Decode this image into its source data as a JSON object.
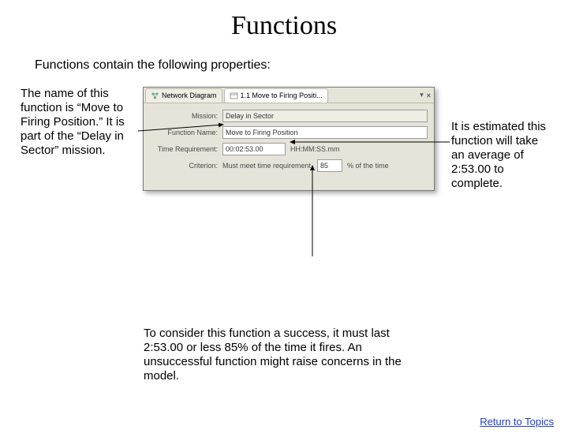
{
  "title": "Functions",
  "intro": "Functions contain the following properties:",
  "left_annotation": "The name of this function is “Move to Firing Position.”  It is part of the “Delay in Sector” mission.",
  "right_annotation": "It is estimated this function will take an average of 2:53.00 to complete.",
  "bottom_annotation": "To consider this function a success, it must last 2:53.00 or less 85% of the time it fires.  An unsuccessful function might raise concerns in the model.",
  "return_link": "Return to Topics",
  "panel": {
    "tabs": {
      "network": "Network Diagram",
      "active": "1.1 Move to Firing Positi..."
    },
    "rows": {
      "mission_label": "Mission:",
      "mission_value": "Delay in Sector",
      "name_label": "Function Name:",
      "name_value": "Move to Firing Position",
      "time_label": "Time Requirement:",
      "time_value": "00:02:53.00",
      "time_hint": "HH:MM:SS.mm",
      "criterion_label": "Criterion:",
      "criterion_text": "Must meet time requirement",
      "criterion_pct": "85",
      "criterion_suffix": "% of the time"
    }
  }
}
